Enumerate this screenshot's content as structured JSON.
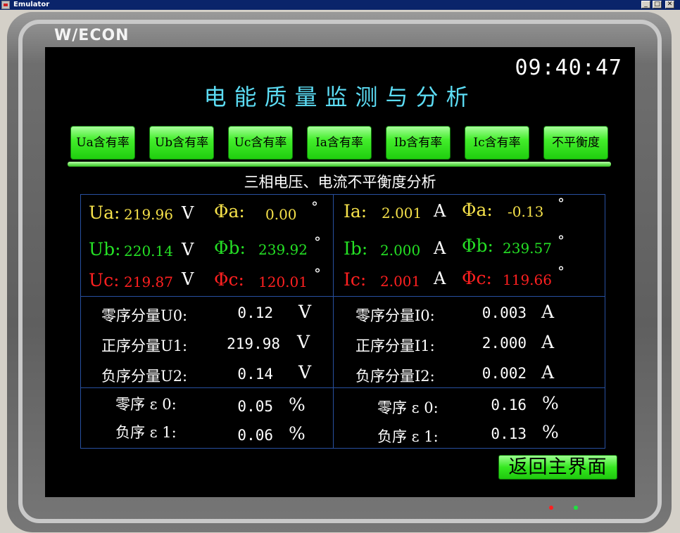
{
  "window": {
    "title": "Emulator",
    "min": "_",
    "max": "□",
    "close": "✕"
  },
  "device": {
    "logo": "W/ECON"
  },
  "screen": {
    "clock": "09:40:47",
    "title": "电能质量监测与分析",
    "tabs": [
      "Ua含有率",
      "Ub含有率",
      "Uc含有率",
      "Ia含有率",
      "Ib含有率",
      "Ic含有率",
      "不平衡度"
    ],
    "section_title": "三相电压、电流不平衡度分析",
    "voltage": [
      {
        "label": "Ua:",
        "value": "219.96",
        "unit": "V",
        "phase_label": "Φa:",
        "phase_value": "0.00",
        "deg": "°",
        "color": "#f5e14a"
      },
      {
        "label": "Ub:",
        "value": "220.14",
        "unit": "V",
        "phase_label": "Φb:",
        "phase_value": "239.92",
        "deg": "°",
        "color": "#25e025"
      },
      {
        "label": "Uc:",
        "value": "219.87",
        "unit": "V",
        "phase_label": "Φc:",
        "phase_value": "120.01",
        "deg": "°",
        "color": "#ff2020"
      }
    ],
    "current": [
      {
        "label": "Ia:",
        "value": "2.001",
        "unit": "A",
        "phase_label": "Φa:",
        "phase_value": "-0.13",
        "deg": "°",
        "color": "#f5e14a"
      },
      {
        "label": "Ib:",
        "value": "2.000",
        "unit": "A",
        "phase_label": "Φb:",
        "phase_value": "239.57",
        "deg": "°",
        "color": "#25e025"
      },
      {
        "label": "Ic:",
        "value": "2.001",
        "unit": "A",
        "phase_label": "Φc:",
        "phase_value": "119.66",
        "deg": "°",
        "color": "#ff2020"
      }
    ],
    "voltage_seq": [
      {
        "label": "零序分量U0:",
        "value": "0.12",
        "unit": "V"
      },
      {
        "label": "正序分量U1:",
        "value": "219.98",
        "unit": "V"
      },
      {
        "label": "负序分量U2:",
        "value": "0.14",
        "unit": "V"
      }
    ],
    "current_seq": [
      {
        "label": "零序分量I0:",
        "value": "0.003",
        "unit": "A"
      },
      {
        "label": "正序分量I1:",
        "value": "2.000",
        "unit": "A"
      },
      {
        "label": "负序分量I2:",
        "value": "0.002",
        "unit": "A"
      }
    ],
    "voltage_unbalance": [
      {
        "label": "零序 ε 0:",
        "value": "0.05",
        "unit": "%"
      },
      {
        "label": "负序 ε 1:",
        "value": "0.06",
        "unit": "%"
      }
    ],
    "current_unbalance": [
      {
        "label": "零序 ε 0:",
        "value": "0.16",
        "unit": "%"
      },
      {
        "label": "负序 ε 1:",
        "value": "0.13",
        "unit": "%"
      }
    ],
    "return_button": "返回主界面"
  },
  "colors": {
    "title": "#5cdcf4",
    "button_green": "#35e820",
    "grid": "#2850a0",
    "led_red": "#ff2020",
    "led_green": "#20e040"
  }
}
